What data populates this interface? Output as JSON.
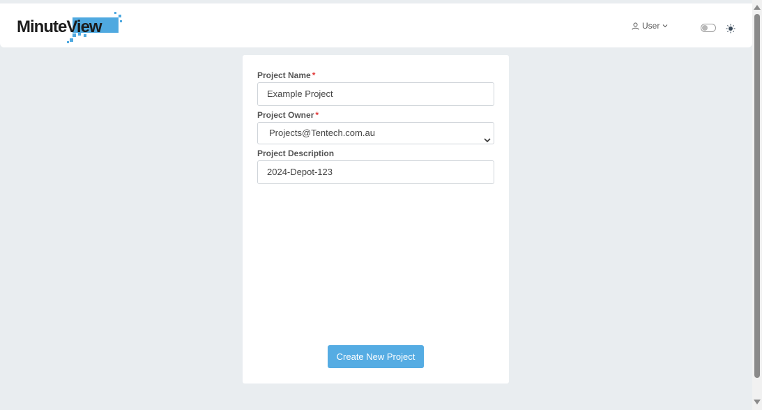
{
  "header": {
    "logo_text_dark": "Minute",
    "logo_text_light": "View",
    "user_label": "User",
    "theme_toggle_on": false
  },
  "form": {
    "project_name": {
      "label": "Project Name",
      "required_mark": "*",
      "value": "Example Project"
    },
    "project_owner": {
      "label": "Project Owner",
      "required_mark": "*",
      "value": "Projects@Tentech.com.au"
    },
    "project_description": {
      "label": "Project Description",
      "value": "2024-Depot-123"
    },
    "submit_label": "Create New Project"
  },
  "colors": {
    "accent": "#55ace3",
    "required": "#e23b3b",
    "background": "#e9edf0"
  }
}
